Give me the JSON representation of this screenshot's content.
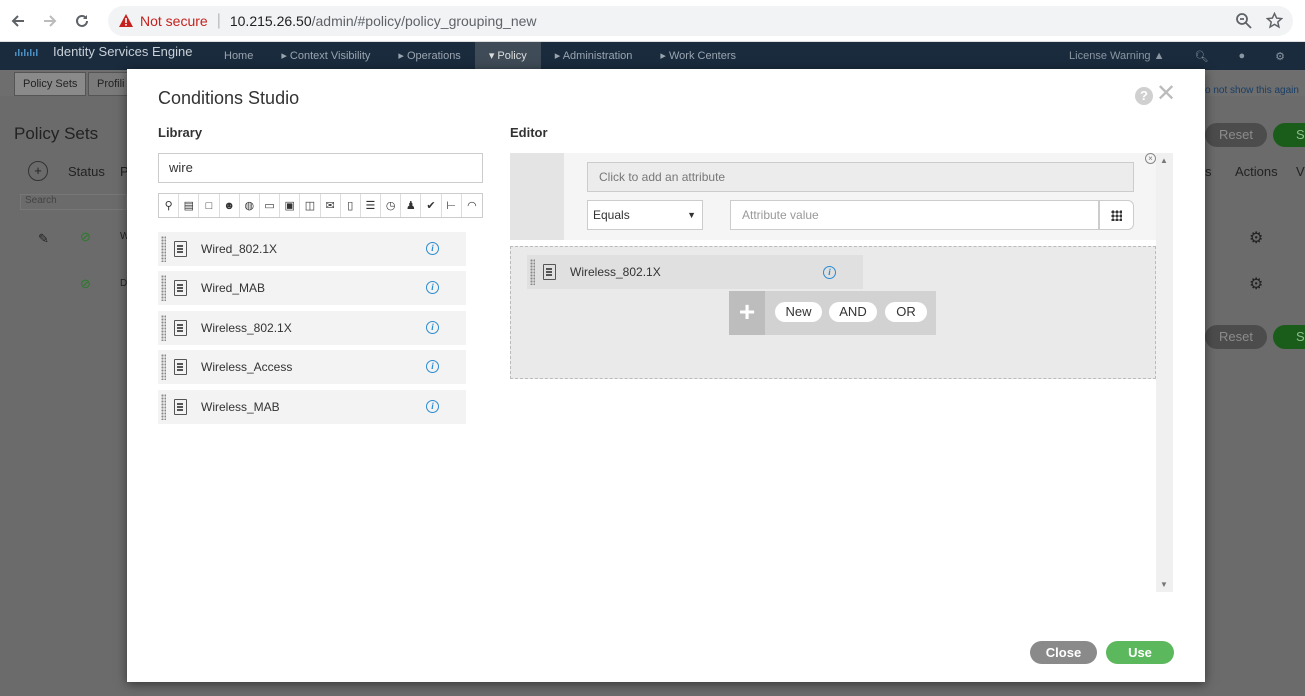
{
  "browser": {
    "not_secure": "Not secure",
    "url_host": "10.215.26.50",
    "url_path": "/admin/#policy/policy_grouping_new"
  },
  "ise": {
    "title": "Identity Services Engine",
    "menu": [
      "Home",
      "▸ Context Visibility",
      "▸ Operations",
      "▾ Policy",
      "▸ Administration",
      "▸ Work Centers"
    ],
    "license_warning": "License Warning ▲",
    "sub_tabs": [
      "Policy Sets",
      "Profili"
    ],
    "dont_show": "o not show this again",
    "page_title": "Policy Sets",
    "col_status": "Status",
    "col_p": "P",
    "search": "Search",
    "col_s": "s",
    "col_actions": "Actions",
    "col_v": "V",
    "reset": "Reset",
    "save": "Sa",
    "row_w": "W",
    "row_d": "D"
  },
  "modal": {
    "title": "Conditions Studio",
    "help": "?",
    "close_x": "✕",
    "library_label": "Library",
    "editor_label": "Editor",
    "search_value": "wire",
    "filter_icons": [
      "location-icon",
      "id-card-icon",
      "square-icon",
      "group-icon",
      "globe-icon",
      "monitor-icon",
      "monitor-alt-icon",
      "screens-icon",
      "message-icon",
      "file-icon",
      "server-icon",
      "clock-icon",
      "user-icon",
      "checkmark-icon",
      "tree-icon",
      "wifi-icon"
    ],
    "library_items": [
      {
        "label": "Wired_802.1X"
      },
      {
        "label": "Wired_MAB"
      },
      {
        "label": "Wireless_802.1X"
      },
      {
        "label": "Wireless_Access"
      },
      {
        "label": "Wireless_MAB"
      }
    ],
    "editor": {
      "attribute_placeholder": "Click to add an attribute",
      "operator": "Equals",
      "value_placeholder": "Attribute value",
      "condition": "Wireless_802.1X",
      "new_label": "New",
      "and_label": "AND",
      "or_label": "OR"
    },
    "close_button": "Close",
    "use_button": "Use"
  }
}
